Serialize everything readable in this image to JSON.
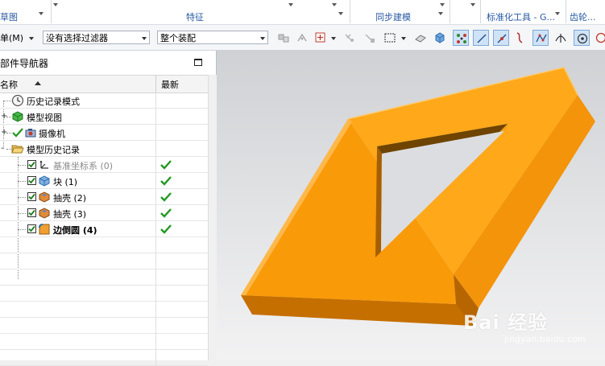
{
  "ribbon": {
    "groups": [
      {
        "label": "草图"
      },
      {
        "label": "特征"
      },
      {
        "label": "同步建模"
      },
      {
        "label": "标准化工具 - G..."
      },
      {
        "label": "齿轮..."
      }
    ]
  },
  "toolbar": {
    "menu_label": "单(M)",
    "filter_value": "没有选择过滤器",
    "scope_value": "整个装配"
  },
  "navigator": {
    "title": "部件导航器",
    "columns": {
      "name": "名称",
      "latest": "最新"
    },
    "rows": [
      {
        "label": "历史记录模式",
        "icon": "clock-icon"
      },
      {
        "label": "模型视图",
        "icon": "model-views-icon"
      },
      {
        "label": "摄像机",
        "icon": "camera-icon"
      },
      {
        "label": "模型历史记录",
        "icon": "folder-open-icon"
      },
      {
        "label": "基准坐标系 (0)",
        "icon": "datum-csys-icon",
        "latest": true
      },
      {
        "label": "块 (1)",
        "icon": "block-icon",
        "latest": true
      },
      {
        "label": "抽壳 (2)",
        "icon": "shell-icon",
        "latest": true
      },
      {
        "label": "抽壳 (3)",
        "icon": "shell-icon",
        "latest": true
      },
      {
        "label": "边倒圆 (4)",
        "icon": "edge-blend-icon",
        "latest": true
      }
    ]
  },
  "viewport": {
    "model_color": "#ffa500",
    "watermark": "Bai  经验",
    "watermark_url": "jingyan.baidu.com"
  }
}
